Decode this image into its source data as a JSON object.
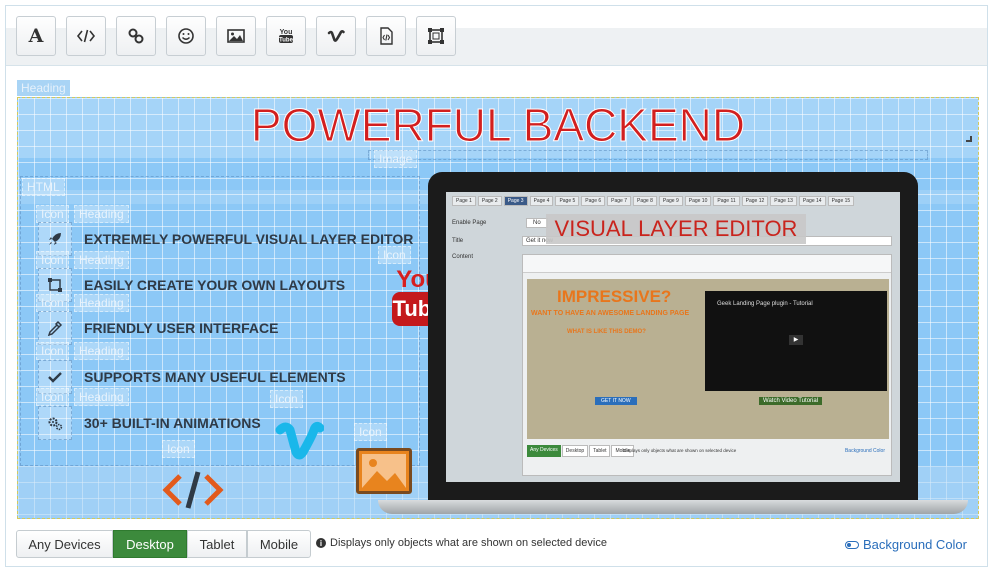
{
  "toolbar": {
    "buttons": [
      {
        "name": "text-tool",
        "icon": "letter-a-icon"
      },
      {
        "name": "html-tool",
        "icon": "code-icon"
      },
      {
        "name": "link-tool",
        "icon": "link-icon"
      },
      {
        "name": "icon-tool",
        "icon": "smiley-icon"
      },
      {
        "name": "image-tool",
        "icon": "image-icon"
      },
      {
        "name": "youtube-tool",
        "icon": "youtube-icon",
        "label": "You Tube"
      },
      {
        "name": "vimeo-tool",
        "icon": "vimeo-icon",
        "label": "V"
      },
      {
        "name": "code-file-tool",
        "icon": "code-file-icon"
      },
      {
        "name": "frame-tool",
        "icon": "frame-icon"
      }
    ]
  },
  "canvas": {
    "labels": {
      "heading": "Heading",
      "image": "Image",
      "html": "HTML",
      "icon": "Icon"
    },
    "title": "POWERFUL BACKEND",
    "features": [
      {
        "icon": "rocket-icon",
        "text": "EXTREMELY POWERFUL VISUAL LAYER EDITOR"
      },
      {
        "icon": "layout-icon",
        "text": "EASILY CREATE YOUR OWN LAYOUTS"
      },
      {
        "icon": "eyedropper-icon",
        "text": "FRIENDLY USER INTERFACE"
      },
      {
        "icon": "check-icon",
        "text": "SUPPORTS MANY USEFUL ELEMENTS"
      },
      {
        "icon": "gears-icon",
        "text": "30+ BUILT-IN ANIMATIONS"
      }
    ],
    "youtube_logo": {
      "top": "You",
      "bottom": "Tube"
    },
    "vimeo_logo": "V",
    "code_logo": "</>",
    "laptop_screen": {
      "tabs": [
        "Page 1",
        "Page 2",
        "Page 3",
        "Page 4",
        "Page 5",
        "Page 6",
        "Page 7",
        "Page 8",
        "Page 9",
        "Page 10",
        "Page 11",
        "Page 12",
        "Page 13",
        "Page 14",
        "Page 15"
      ],
      "active_tab": "Page 3",
      "form_labels": {
        "enable": "Enable Page",
        "title": "Title",
        "content": "Content"
      },
      "enable_value": "No",
      "title_value": "Get it now",
      "overlay_heading": "VISUAL LAYER EDITOR",
      "inner_headline": "IMPRESSIVE?",
      "inner_sub1": "WANT TO HAVE AN AWESOME LANDING PAGE",
      "inner_sub2": "WHAT IS LIKE THIS DEMO?",
      "video_title": "Geek Landing Page plugin - Tutorial",
      "video_button": "Watch Video Tutorial",
      "cta_button": "GET IT NOW",
      "device_tabs": [
        "Any Devices",
        "Desktop",
        "Tablet",
        "Mobile"
      ],
      "device_note": "Displays only objects what are shown on selected device",
      "bg_link": "Background Color"
    }
  },
  "bottom": {
    "devices": [
      "Any Devices",
      "Desktop",
      "Tablet",
      "Mobile"
    ],
    "active_device": "Desktop",
    "note": "Displays only objects what are shown on selected device",
    "background_color_link": "Background Color"
  },
  "colors": {
    "accent_green": "#3c8a3c",
    "title_red": "#d21f1f",
    "link_blue": "#2a6ebb",
    "canvas_blue": "#8cc8f6"
  }
}
